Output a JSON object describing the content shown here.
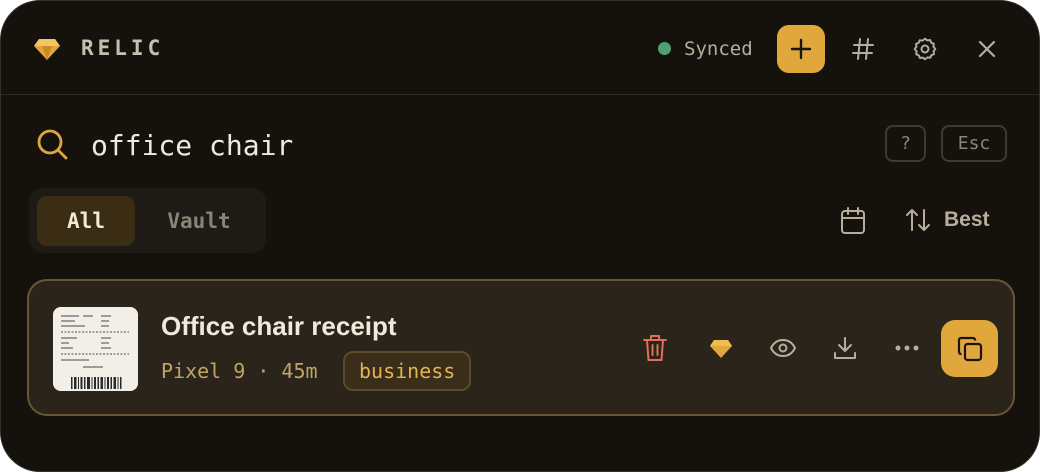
{
  "app": {
    "name": "RELIC"
  },
  "header": {
    "sync_status": "Synced",
    "colors": {
      "accent": "#e0a73d",
      "sync": "#4fa070"
    },
    "icons": [
      "gem-icon",
      "plus-icon",
      "hash-icon",
      "gear-icon",
      "close-icon"
    ]
  },
  "search": {
    "value": "office chair",
    "help_key": "?",
    "escape_key": "Esc"
  },
  "filters": {
    "tabs": [
      {
        "label": "All",
        "selected": true
      },
      {
        "label": "Vault",
        "selected": false
      }
    ],
    "sort_label": "Best"
  },
  "results": [
    {
      "title": "Office chair receipt",
      "meta": "Pixel 9 · 45m",
      "tag": "business",
      "actions": [
        "trash-icon",
        "gem-icon",
        "eye-icon",
        "download-icon",
        "more-icon",
        "copy-icon"
      ]
    }
  ]
}
